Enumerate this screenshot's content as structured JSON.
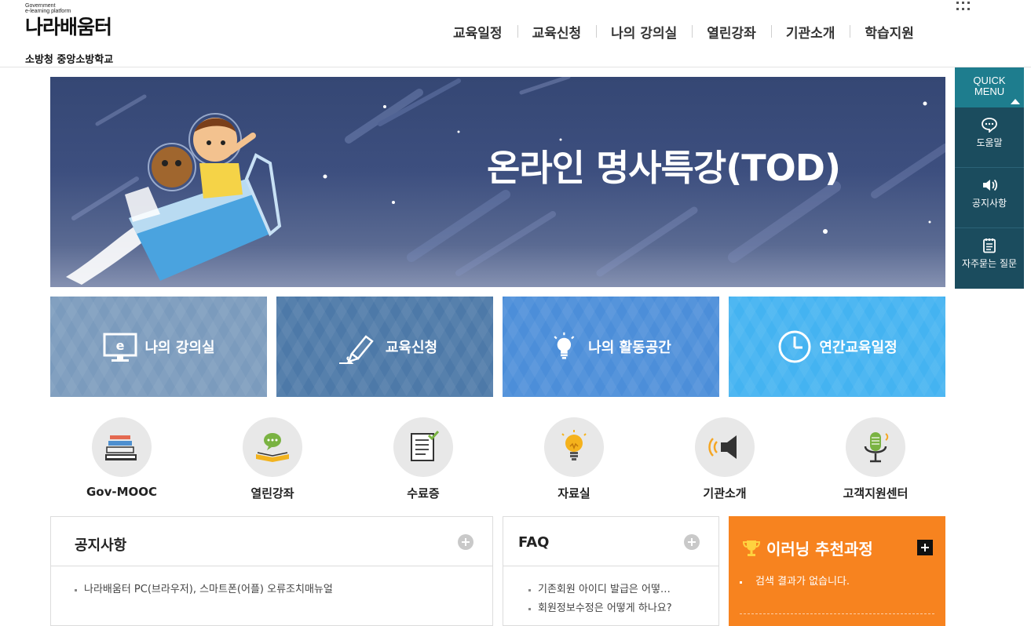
{
  "logo": {
    "top_text_1": "Government",
    "top_text_2": "e-learning platform",
    "name": "나라배움터",
    "org": "소방청 중앙소방학교"
  },
  "gnb": {
    "items": [
      {
        "label": "교육일정"
      },
      {
        "label": "교육신청"
      },
      {
        "label": "나의 강의실"
      },
      {
        "label": "열린강좌"
      },
      {
        "label": "기관소개"
      },
      {
        "label": "학습지원"
      }
    ],
    "all_menu_icon": "grid-dots-icon"
  },
  "banner": {
    "title": "온라인 명사특강(TOD)"
  },
  "quick_menu": {
    "title_line1": "QUICK",
    "title_line2": "MENU",
    "items": [
      {
        "label": "도움말",
        "icon": "chat-bubble-icon"
      },
      {
        "label": "공지사항",
        "icon": "speaker-icon"
      },
      {
        "label": "자주묻는 질문",
        "icon": "notepad-icon"
      }
    ]
  },
  "tiles": [
    {
      "label": "나의 강의실",
      "icon": "monitor-e-icon",
      "color": "#7b9bbd"
    },
    {
      "label": "교육신청",
      "icon": "pen-icon",
      "color": "#4d79a8"
    },
    {
      "label": "나의 활동공간",
      "icon": "lightbulb-icon",
      "color": "#4c8ed9"
    },
    {
      "label": "연간교육일정",
      "icon": "clock-icon",
      "color": "#44b3f1"
    }
  ],
  "circle_links": [
    {
      "label": "Gov-MOOC",
      "icon": "books-icon"
    },
    {
      "label": "열린강좌",
      "icon": "open-book-icon"
    },
    {
      "label": "수료증",
      "icon": "certificate-icon"
    },
    {
      "label": "자료실",
      "icon": "bulb-icon"
    },
    {
      "label": "기관소개",
      "icon": "megaphone-icon"
    },
    {
      "label": "고객지원센터",
      "icon": "microphone-icon"
    }
  ],
  "notice": {
    "title": "공지사항",
    "items": [
      "나라배움터 PC(브라우저), 스마트폰(어플) 오류조치매뉴얼"
    ]
  },
  "faq": {
    "title": "FAQ",
    "items": [
      "기존회원 아이디 발급은 어떻…",
      "회원정보수정은 어떻게 하나요?"
    ]
  },
  "recommend": {
    "title": "이러닝 추천과정",
    "empty_text": "검색 결과가 없습니다."
  }
}
